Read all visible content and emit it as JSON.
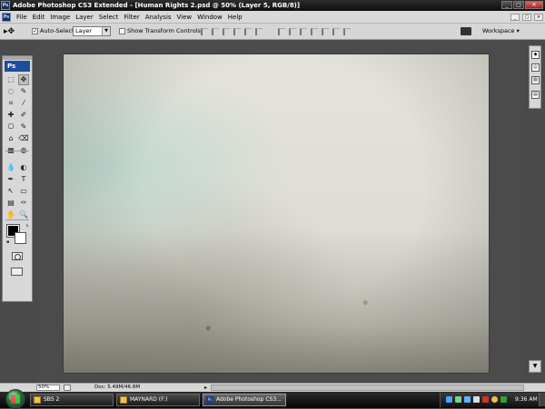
{
  "window": {
    "title": "Adobe Photoshop CS3 Extended - [Human Rights 2.psd @ 50% (Layer 5, RGB/8)]",
    "app_logo": "Ps",
    "minimize": "_",
    "maximize": "□",
    "close": "✕"
  },
  "menubar": {
    "logo": "Ps",
    "items": [
      "File",
      "Edit",
      "Image",
      "Layer",
      "Select",
      "Filter",
      "Analysis",
      "View",
      "Window",
      "Help"
    ],
    "doc_buttons": [
      "_",
      "□",
      "✕"
    ]
  },
  "options": {
    "tool_icon": "move-tool-icon",
    "tool_glyph": "▸✥",
    "auto_select_checked": true,
    "auto_select_label": "Auto-Select:",
    "auto_select_value": "Layer",
    "show_transform_label": "Show Transform Controls",
    "show_transform_checked": false,
    "workspace_label": "Workspace ▾"
  },
  "toolbox": {
    "logo": "Ps",
    "tools": [
      [
        "⬚",
        "✥"
      ],
      [
        "◌",
        "✎"
      ],
      [
        "⌗",
        "⁄"
      ],
      [
        "✚",
        "✐"
      ],
      [
        "⎔",
        "✎"
      ],
      [
        "⌂",
        "⌫"
      ],
      [
        "▦",
        "◍"
      ],
      [
        "💧",
        "◐"
      ],
      [
        "✒",
        "T"
      ],
      [
        "↖",
        "▭"
      ],
      [
        "▤",
        "✑"
      ],
      [
        "✋",
        "🔍"
      ]
    ],
    "active_tool": "move-tool"
  },
  "statusbar": {
    "zoom": "50%",
    "doc_info": "Doc: 5.49M/46.8M",
    "arrow": "▸"
  },
  "taskbar": {
    "items": [
      {
        "label": "SBS 2",
        "icon": "folder-icon"
      },
      {
        "label": "MAYNARD (F:)",
        "icon": "folder-icon"
      },
      {
        "label": "Adobe Photoshop CS3...",
        "icon": "photoshop-icon",
        "active": true
      }
    ],
    "clock": "9:36 AM"
  },
  "colors": {
    "accent": "#1d4d9c",
    "workspace_bg": "#4b4b4b",
    "canvas_tone": "#deddd5"
  }
}
